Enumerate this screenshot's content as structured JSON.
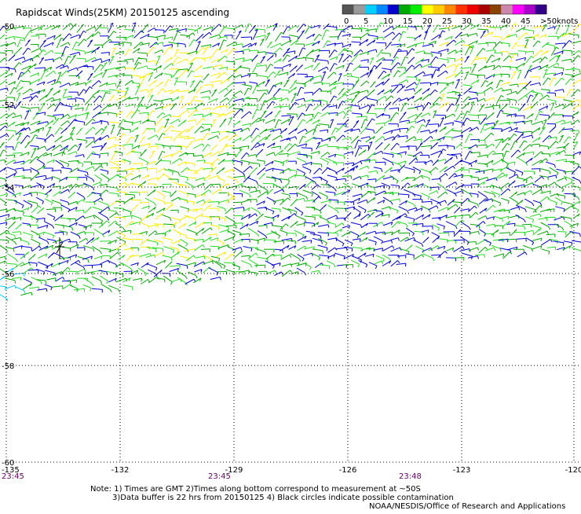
{
  "title": "Rapidscat Winds(25KM) 20150125 ascending",
  "legend": {
    "unit": "knots",
    "labels": [
      "0",
      "5",
      "10",
      "15",
      "20",
      "25",
      "30",
      "35",
      "40",
      "45",
      ">50"
    ],
    "colors": [
      "#555555",
      "#9a9a9a",
      "#00d0ff",
      "#0088ff",
      "#0000cc",
      "#00aa00",
      "#00ee00",
      "#ffff00",
      "#ffcc00",
      "#ff8800",
      "#ff3300",
      "#ee0000",
      "#aa0000",
      "#884400",
      "#cc88aa",
      "#ff00ff",
      "#aa00cc",
      "#330088"
    ]
  },
  "map": {
    "lon_range": [
      -135,
      -120
    ],
    "lat_range": [
      -60,
      -50
    ],
    "lon_ticks": [
      "-135",
      "-132",
      "-129",
      "-126",
      "-123",
      "-120"
    ],
    "lat_ticks": [
      "-50",
      "-52",
      "-54",
      "-56",
      "-58",
      "-60"
    ],
    "lat_values": [
      -50,
      -52,
      -54,
      -56,
      -58,
      -60
    ],
    "lon_values": [
      -135,
      -132,
      -129,
      -126,
      -123,
      -120
    ],
    "wind_colors": {
      "blue": "#0000dd",
      "green": "#00aa00",
      "lightgreen": "#22dd22",
      "yellow": "#ffee00",
      "cyan": "#00ccff",
      "black": "#000000"
    }
  },
  "times": [
    "23:45",
    "23:45",
    "23:48"
  ],
  "notes": {
    "line1": "Note: 1) Times are GMT 2)Times along bottom correspond to measurement at ~50S",
    "line2": "3)Data buffer is 22 hrs from 20150125 4) Black circles indicate possible contamination",
    "credit": "NOAA/NESDIS/Office of Research and Applications"
  }
}
